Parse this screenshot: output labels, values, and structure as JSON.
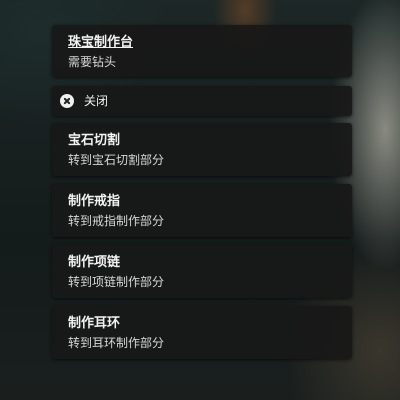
{
  "menu": {
    "header": {
      "title": "珠宝制作台",
      "subtitle": "需要钻头"
    },
    "close": {
      "label": "关闭",
      "icon": "close-icon"
    },
    "items": [
      {
        "title": "宝石切割",
        "description": "转到宝石切割部分"
      },
      {
        "title": "制作戒指",
        "description": "转到戒指制作部分"
      },
      {
        "title": "制作项链",
        "description": "转到项链制作部分"
      },
      {
        "title": "制作耳环",
        "description": "转到耳环制作部分"
      }
    ]
  }
}
